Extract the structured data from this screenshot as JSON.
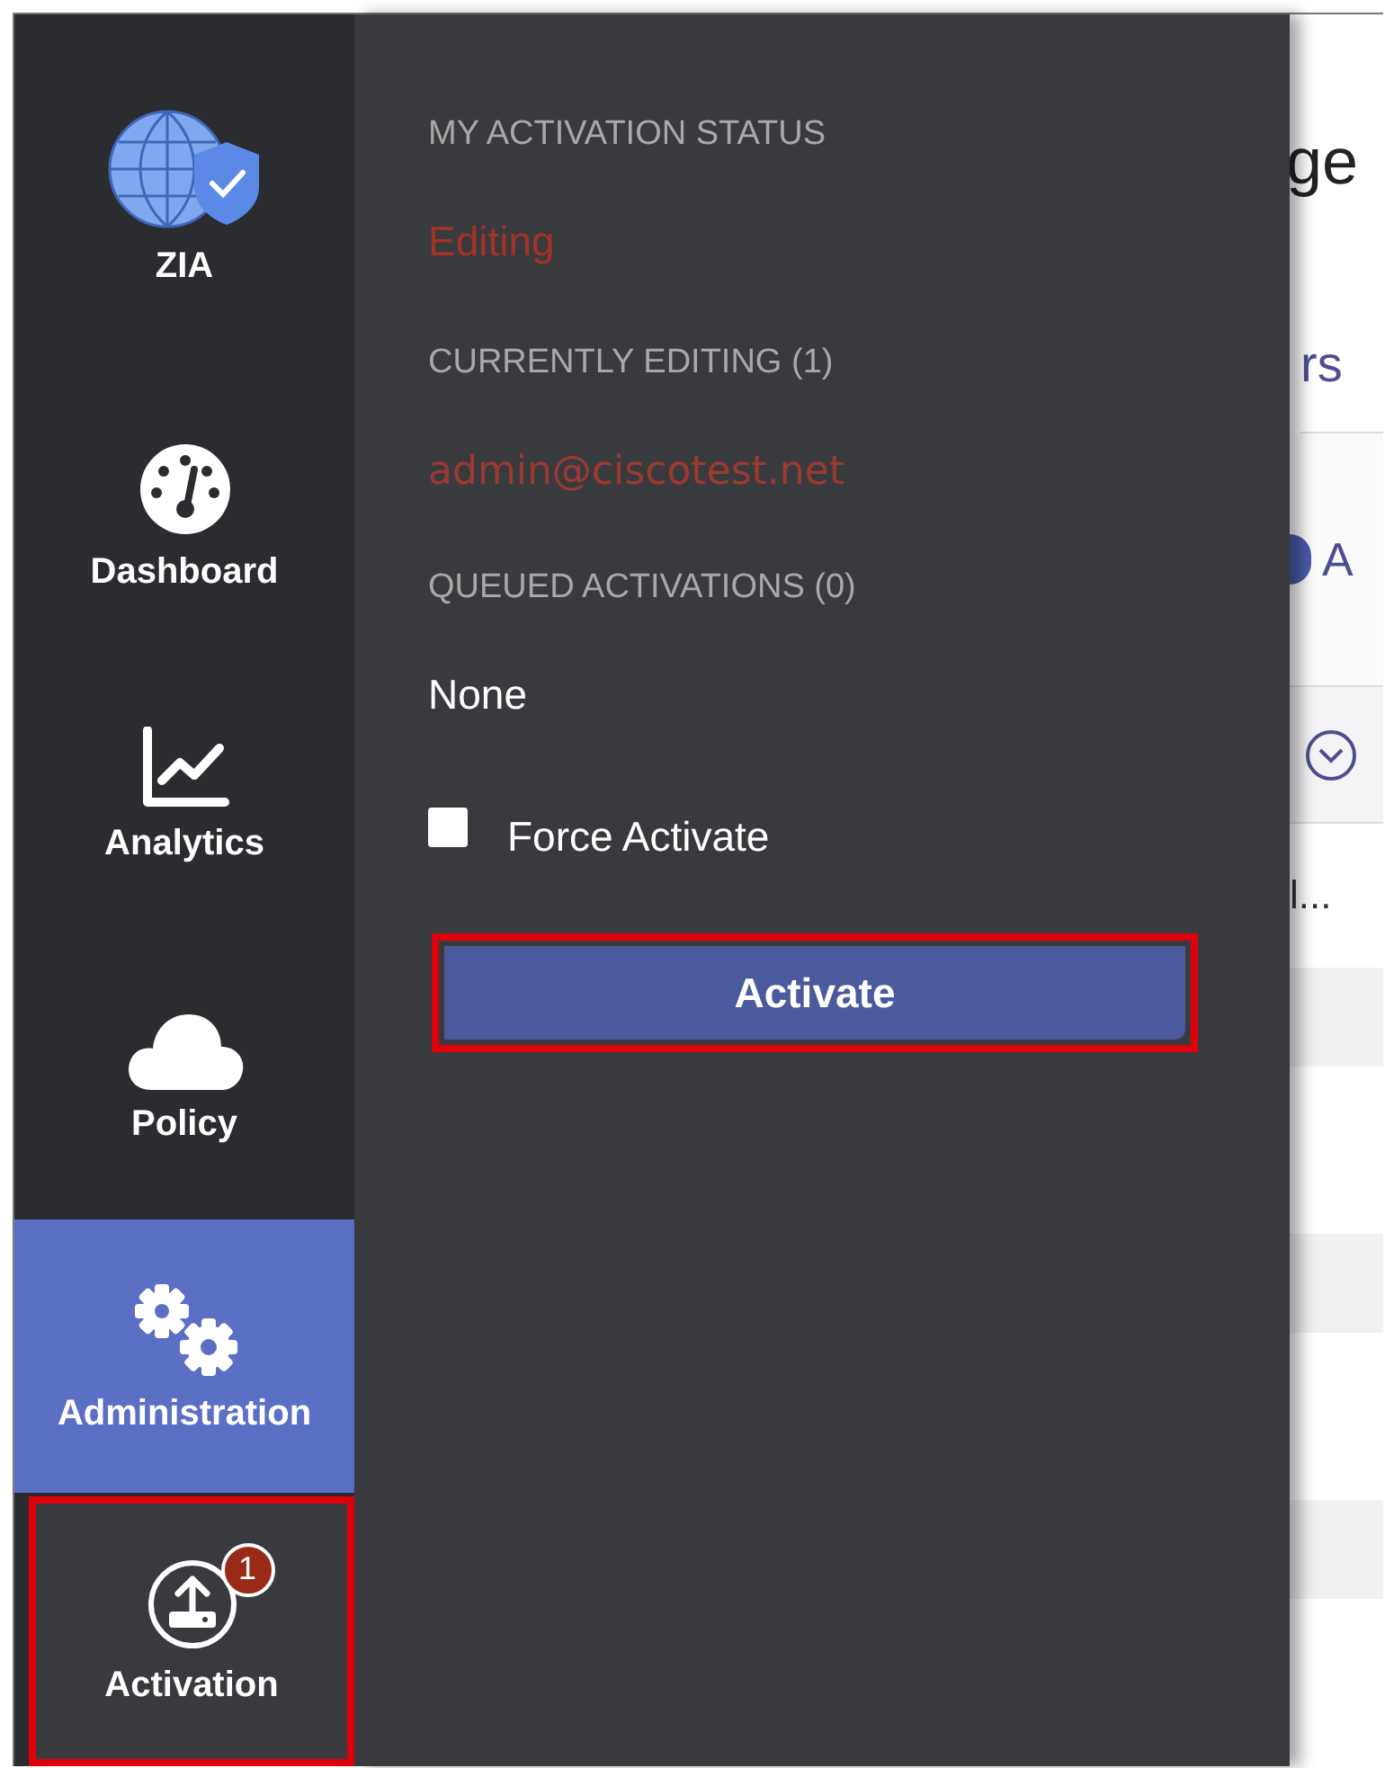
{
  "sidebar": {
    "items": [
      {
        "label": "ZIA",
        "selected": false,
        "highlighted": false
      },
      {
        "label": "Dashboard",
        "selected": false,
        "highlighted": false
      },
      {
        "label": "Analytics",
        "selected": false,
        "highlighted": false
      },
      {
        "label": "Policy",
        "selected": false,
        "highlighted": false
      },
      {
        "label": "Administration",
        "selected": true,
        "highlighted": false
      },
      {
        "label": "Activation",
        "selected": false,
        "highlighted": true,
        "badge": "1"
      }
    ]
  },
  "activation_panel": {
    "status_heading": "MY ACTIVATION STATUS",
    "status": "Editing",
    "editing_heading": "CURRENTLY EDITING (1)",
    "editors": [
      "admin@ciscotest.net"
    ],
    "queued_heading": "QUEUED ACTIVATIONS (0)",
    "queued": "None",
    "force_activate": {
      "label": "Force Activate",
      "checked": false
    },
    "activate_button": {
      "label": "Activate",
      "highlighted": true
    }
  },
  "background_page": {
    "title": "ge",
    "tab": "rs",
    "add_link": "A",
    "row_text": "l..."
  }
}
